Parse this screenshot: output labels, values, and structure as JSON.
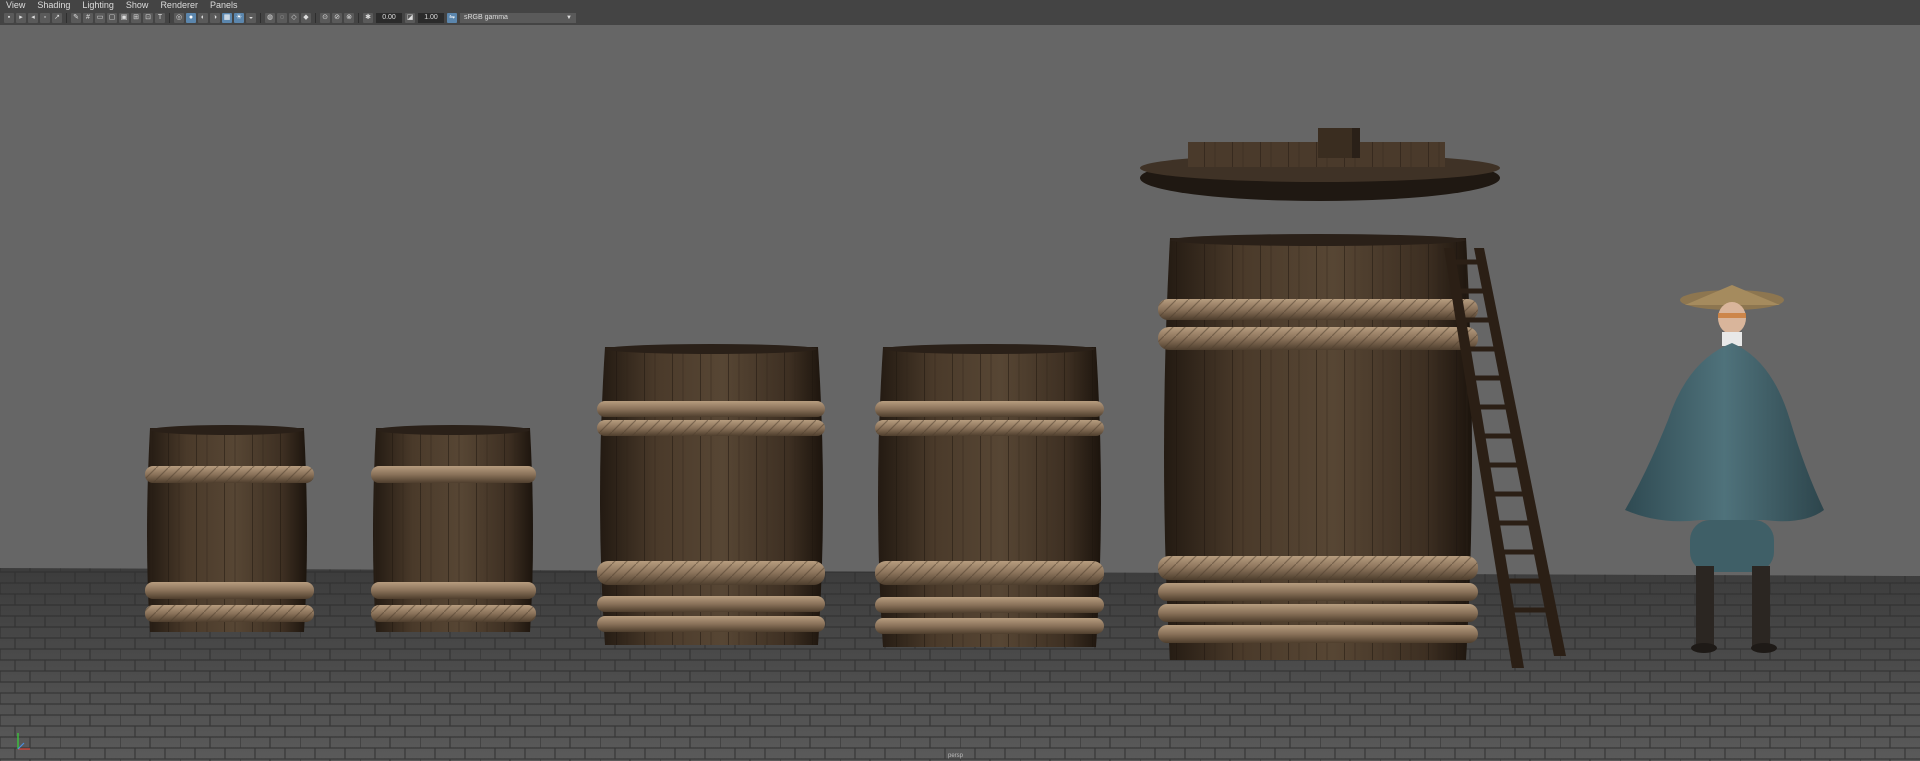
{
  "menu": [
    "View",
    "Shading",
    "Lighting",
    "Show",
    "Renderer",
    "Panels"
  ],
  "toolbar": {
    "exposure": "0.00",
    "gamma": "1.00",
    "color_space": "sRGB gamma"
  },
  "viewport": {
    "camera": "persp",
    "background": "#666666",
    "objects": [
      "barrel",
      "barrel",
      "barrel",
      "barrel",
      "large-barrel",
      "barrel-lid",
      "ladder",
      "character"
    ]
  }
}
